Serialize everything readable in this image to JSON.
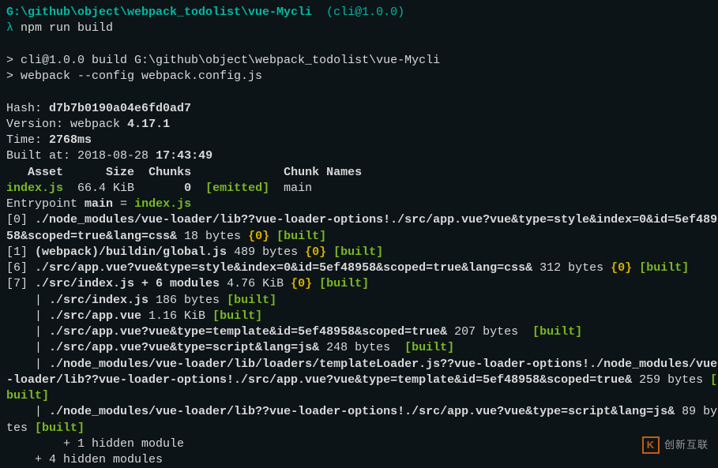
{
  "prompt": {
    "path": "G:\\github\\object\\webpack_todolist\\vue-Mycli",
    "pkglabel": "(cli@1.0.0)",
    "lambda": "λ",
    "cmd": "npm run build"
  },
  "output": {
    "scriptLine1": "> cli@1.0.0 build G:\\github\\object\\webpack_todolist\\vue-Mycli",
    "scriptLine2": "> webpack --config webpack.config.js"
  },
  "summary": {
    "hashLabel": "Hash:",
    "hash": "d7b7b0190a04e6fd0ad7",
    "versionLabel": "Version:",
    "versionName": "webpack",
    "versionNum": "4.17.1",
    "timeLabel": "Time:",
    "time": "2768ms",
    "builtLabel": "Built at:",
    "builtDate": "2018-08-28",
    "builtTime": "17:43:49"
  },
  "table": {
    "h_asset": "Asset",
    "h_size": "Size",
    "h_chunks": "Chunks",
    "h_chunkNames": "Chunk Names",
    "asset": "index.js",
    "size": "66.4 KiB",
    "chunk": "0",
    "emitted": "[emitted]",
    "chunkName": "main"
  },
  "entry": {
    "prefix": "Entrypoint ",
    "name": "main",
    "eq": " = ",
    "file": "index.js"
  },
  "modules": {
    "m0_idx": "[0]",
    "m0_path": " ./node_modules/vue-loader/lib??vue-loader-options!./src/app.vue?vue&type=style&index=0&id=5ef489",
    "m0_path2": "58&scoped=true&lang=css&",
    "m0_size": " 18 bytes ",
    "m0_chunks": "{0}",
    "m0_built": "[built]",
    "m1_idx": "[1]",
    "m1_path": " (webpack)/buildin/global.js",
    "m1_size": " 489 bytes ",
    "m1_chunks": "{0}",
    "m1_built": "[built]",
    "m6_idx": "[6]",
    "m6_path": " ./src/app.vue?vue&type=style&index=0&id=5ef48958&scoped=true&lang=css&",
    "m6_size": " 312 bytes ",
    "m6_chunks": "{0}",
    "m6_built": "[built]",
    "m7_idx": "[7]",
    "m7_path": " ./src/index.js + 6 modules",
    "m7_size": " 4.76 KiB ",
    "m7_chunks": "{0}",
    "m7_built": "[built]",
    "sub_prefix": "    | ",
    "s1_path": "./src/index.js",
    "s1_size": " 186 bytes ",
    "s1_built": "[built]",
    "s2_path": "./src/app.vue",
    "s2_size": " 1.16 KiB ",
    "s2_built": "[built]",
    "s3_path": "./src/app.vue?vue&type=template&id=5ef48958&scoped=true&",
    "s3_size": " 207 bytes ",
    "s3_built": "[built]",
    "s4_path": "./src/app.vue?vue&type=script&lang=js&",
    "s4_size": " 248 bytes ",
    "s4_built": "[built]",
    "s5_path": "./node_modules/vue-loader/lib/loaders/templateLoader.js??vue-loader-options!./node_modules/vue",
    "s5_path2": "-loader/lib??vue-loader-options!./src/app.vue?vue&type=template&id=5ef48958&scoped=true&",
    "s5_size": " 259 bytes ",
    "s5_open": "[",
    "s5_built": "built",
    "s5_close": "]",
    "s6_path": "./node_modules/vue-loader/lib??vue-loader-options!./src/app.vue?vue&type=script&lang=js&",
    "s6_size": " 89 by",
    "s6_size2": "tes ",
    "s6_built": "[built]",
    "hidden1": "        + 1 hidden module",
    "hidden2": "    + 4 hidden modules"
  },
  "logo": {
    "mark": "K",
    "text": "创新互联"
  }
}
